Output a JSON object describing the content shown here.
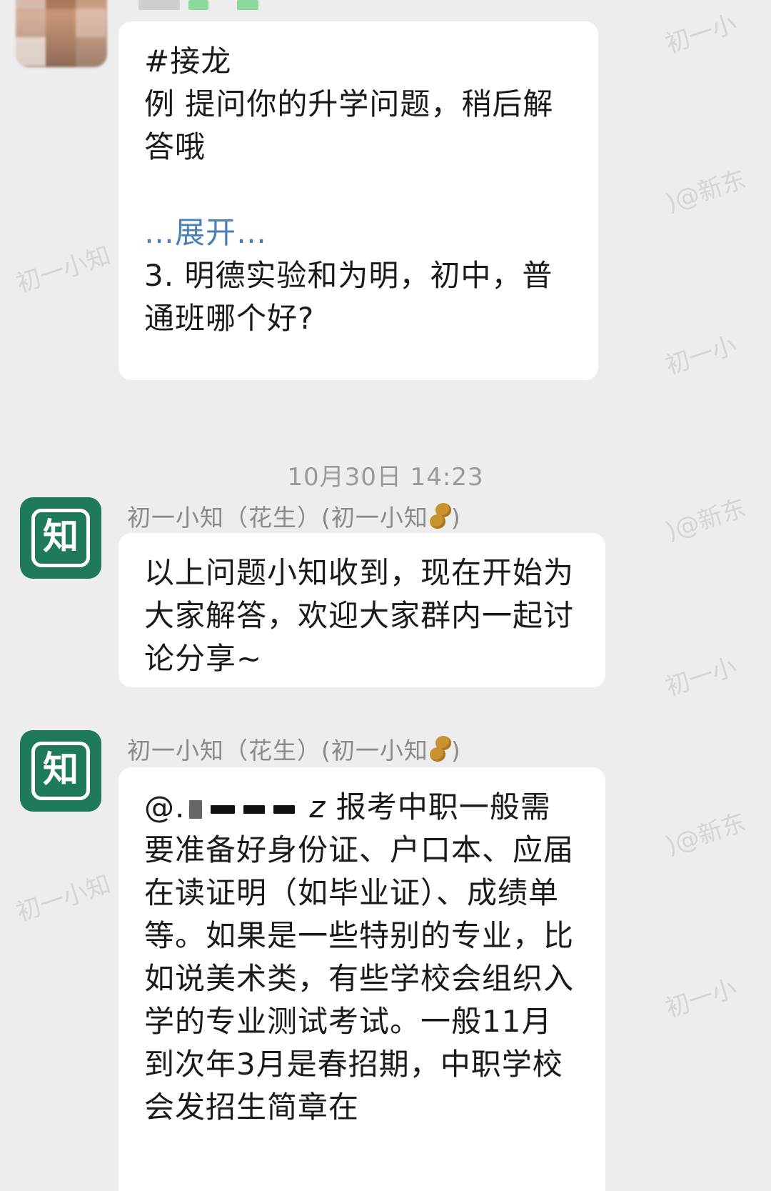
{
  "messages": [
    {
      "id": "msg1",
      "lines": [
        "#接龙",
        "例 提问你的升学问题，稍后解答哦"
      ],
      "expand_label": "…展开…",
      "after_lines": [
        "3. 明德实验和为明，初中，普通班哪个好?"
      ]
    }
  ],
  "timestamp": "10月30日  14:23",
  "sender": {
    "name": "初一小知（花生）(初一小知",
    "name_suffix": ")",
    "peanut_icon": "peanut-icon",
    "avatar_glyph": "知"
  },
  "msg2": {
    "text": "以上问题小知收到，现在开始为大家解答，欢迎大家群内一起讨论分享~"
  },
  "msg3": {
    "mention_prefix": "@.",
    "mention_suffix": "z",
    "text_after_mention": " 报考中职一般需要准备好身份证、户口本、应届在读证明（如毕业证）、成绩单等。如果是一些特别的专业，比如说美术类，有些学校会组织入学的专业测试考试。一般11月到次年3月是春招期，中职学校会发招生简章在"
  },
  "watermarks": {
    "a": "初一小知",
    "b": ")@新东",
    "c": "知",
    "d": "初一小"
  },
  "colors": {
    "background": "#ededed",
    "bubble": "#ffffff",
    "brand_green": "#1f7a5c",
    "link_blue": "#4a7fb8",
    "meta_gray": "#8a8a8a"
  }
}
